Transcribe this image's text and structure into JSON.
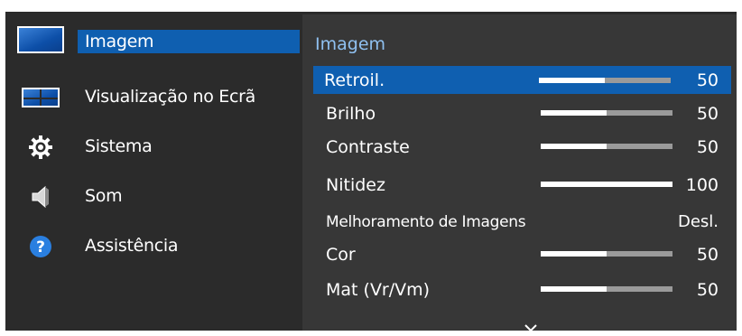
{
  "menu": {
    "items": [
      {
        "label": "Imagem",
        "icon": "picture-icon",
        "selected": true
      },
      {
        "label": "Visualização no Ecrã",
        "icon": "onscreen-display-icon",
        "selected": false
      },
      {
        "label": "Sistema",
        "icon": "gear-icon",
        "selected": false
      },
      {
        "label": "Som",
        "icon": "speaker-icon",
        "selected": false
      },
      {
        "label": "Assistência",
        "icon": "question-icon",
        "selected": false
      }
    ]
  },
  "panel": {
    "title": "Imagem",
    "rows": [
      {
        "name": "Retroil.",
        "value": "50",
        "level": 0.5,
        "selected": true
      },
      {
        "name": "Brilho",
        "value": "50",
        "level": 0.5
      },
      {
        "name": "Contraste",
        "value": "50",
        "level": 0.5
      },
      {
        "name": "Nitidez",
        "value": "100",
        "level": 1.0
      },
      {
        "name": "Melhoramento de Imagens",
        "value": "Desl."
      },
      {
        "name": "Cor",
        "value": "50",
        "level": 0.5
      },
      {
        "name": "Mat (Vr/Vm)",
        "value": "50",
        "level": 0.5
      }
    ],
    "more_icon": "chevron-down-icon"
  },
  "colors": {
    "accent": "#0f5fb0",
    "title": "#8fc0f0",
    "background": "#2b2b2b",
    "panel": "#373737"
  }
}
